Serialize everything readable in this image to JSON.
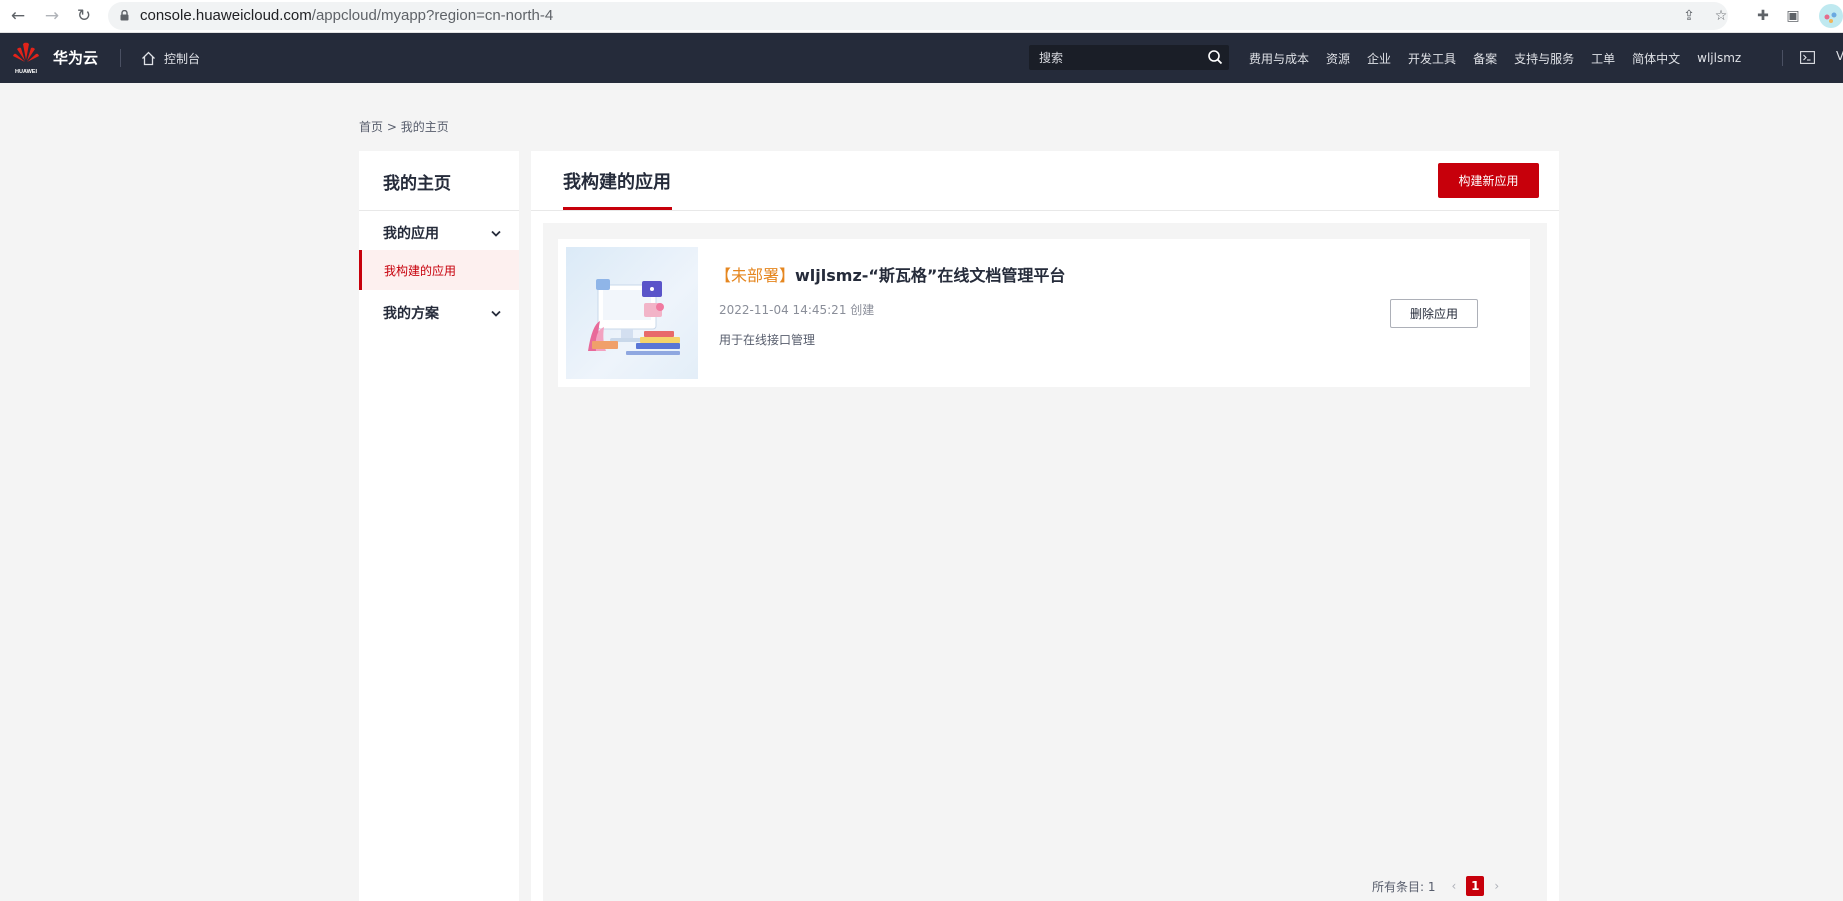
{
  "browser": {
    "url_host": "console.huaweicloud.com",
    "url_path": "/appcloud/myapp?region=cn-north-4"
  },
  "header": {
    "logo_text": "HUAWEI",
    "brand": "华为云",
    "console_label": "控制台",
    "search_placeholder": "搜索",
    "nav": [
      "费用与成本",
      "资源",
      "企业",
      "开发工具",
      "备案",
      "支持与服务",
      "工单",
      "简体中文",
      "wljlsmz"
    ],
    "edge_glyph": "V"
  },
  "breadcrumb": {
    "home": "首页",
    "separator": ">",
    "current": "我的主页"
  },
  "sidebar": {
    "title": "我的主页",
    "groups": [
      {
        "label": "我的应用"
      },
      {
        "label": "我的方案"
      }
    ],
    "active_item": "我构建的应用"
  },
  "main": {
    "title": "我构建的应用",
    "build_button": "构建新应用",
    "delete_button": "删除应用",
    "apps": [
      {
        "status": "【未部署】",
        "name": "wljlsmz-“斯瓦格”在线文档管理平台",
        "created": "2022-11-04 14:45:21 创建",
        "description": "用于在线接口管理"
      }
    ],
    "pagination": {
      "total_label": "所有条目: 1",
      "current_page": "1",
      "prev": "‹",
      "next": "›"
    }
  },
  "colors": {
    "header_bg": "#252b3a",
    "accent_red": "#c7000b",
    "status_orange": "#e5861f",
    "page_bg": "#f4f4f4"
  }
}
